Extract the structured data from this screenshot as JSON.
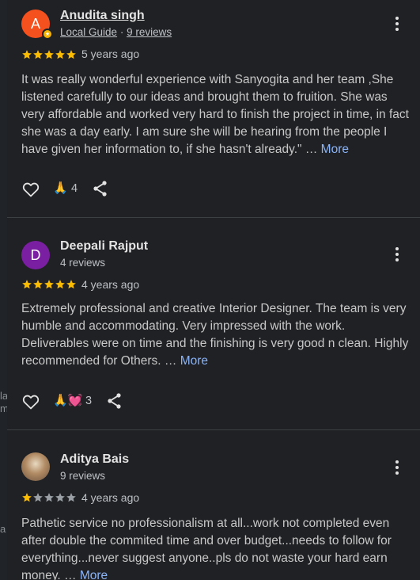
{
  "reviews": [
    {
      "avatar_letter": "A",
      "avatar_color": "#f4511e",
      "name": "Anudita singh",
      "meta_guide": "Local Guide",
      "meta_sep": " · ",
      "meta_reviews": "9 reviews",
      "rating": 5,
      "time": "5 years ago",
      "text": "It was really wonderful experience with Sanyogita and her team ,She listened carefully to our ideas and brought them to fruition. She was very affordable and worked very hard to finish the project in time, in fact she was a day early. I am sure she will be hearing from the people I have given her information to, if she hasn't already.\" …",
      "more": "More",
      "reactions": "🙏",
      "reaction_count": "4"
    },
    {
      "avatar_letter": "D",
      "avatar_color": "#7b1fa2",
      "name": "Deepali Rajput",
      "meta_reviews": "4 reviews",
      "rating": 5,
      "time": "4 years ago",
      "text": "Extremely professional and creative Interior Designer. The team is very humble and accommodating. Very impressed with the work. Deliverables were on time and the finishing is very good n clean. Highly recommended for Others. …",
      "more": "More",
      "reactions": "🙏💓",
      "reaction_count": "3"
    },
    {
      "avatar_color": "#8d6e63",
      "name": "Aditya Bais",
      "meta_reviews": "9 reviews",
      "rating": 1,
      "time": "4 years ago",
      "text": "Pathetic service no professionalism at all...work not completed even after double the commited time and over budget...needs to follow for everything...never suggest anyone..pls do not waste your hard earn money. …",
      "more": "More"
    }
  ],
  "left_fragments": [
    "la",
    "m",
    "a"
  ],
  "colors": {
    "star_filled": "#fbbc04",
    "star_empty": "#9aa0a6",
    "link": "#8ab4f8"
  }
}
